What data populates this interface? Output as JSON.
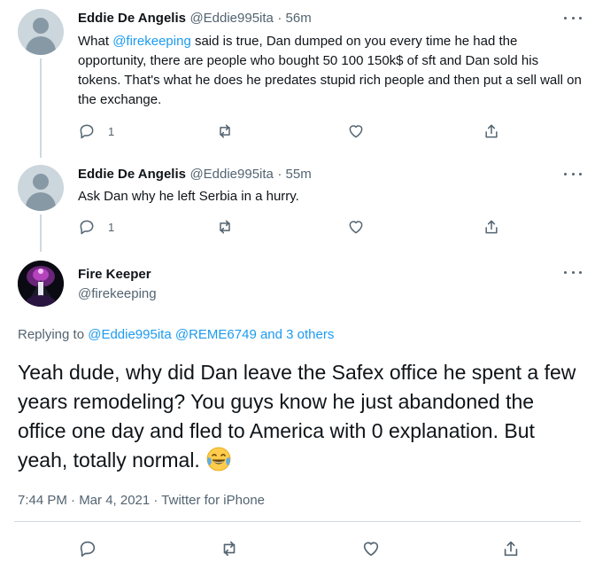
{
  "tweets": [
    {
      "author": "Eddie De Angelis",
      "handle": "@Eddie995ita",
      "time": "· 56m",
      "text_before": "What ",
      "mention": "@firekeeping",
      "text_after": " said is true, Dan dumped on you every time he had the opportunity, there are people who bought 50 100 150k$ of sft and Dan sold his tokens. That's what he does he predates stupid rich people and then put a sell wall on the exchange.",
      "reply_count": "1"
    },
    {
      "author": "Eddie De Angelis",
      "handle": "@Eddie995ita",
      "time": "· 55m",
      "text": "Ask Dan why he left Serbia in a hurry.",
      "reply_count": "1"
    }
  ],
  "main_tweet": {
    "author": "Fire Keeper",
    "handle": "@firekeeping",
    "replying_prefix": "Replying to ",
    "replying_user1": "@Eddie995ita",
    "replying_user2": "@REME6749",
    "replying_others": "and 3 others",
    "text": "Yeah dude, why did Dan leave the Safex office he spent a few years remodeling? You guys know he just abandoned the office one day and fled to America with 0 explanation. But yeah, totally normal.",
    "emoji": "face-with-tears-of-joy",
    "timestamp": "7:44 PM · Mar 4, 2021 · Twitter for iPhone"
  },
  "colors": {
    "accent": "#1d9bf0",
    "secondary_text": "#536471",
    "divider": "#cfd9de"
  },
  "icons": [
    "reply-icon",
    "retweet-icon",
    "like-icon",
    "share-icon",
    "more-icon"
  ]
}
